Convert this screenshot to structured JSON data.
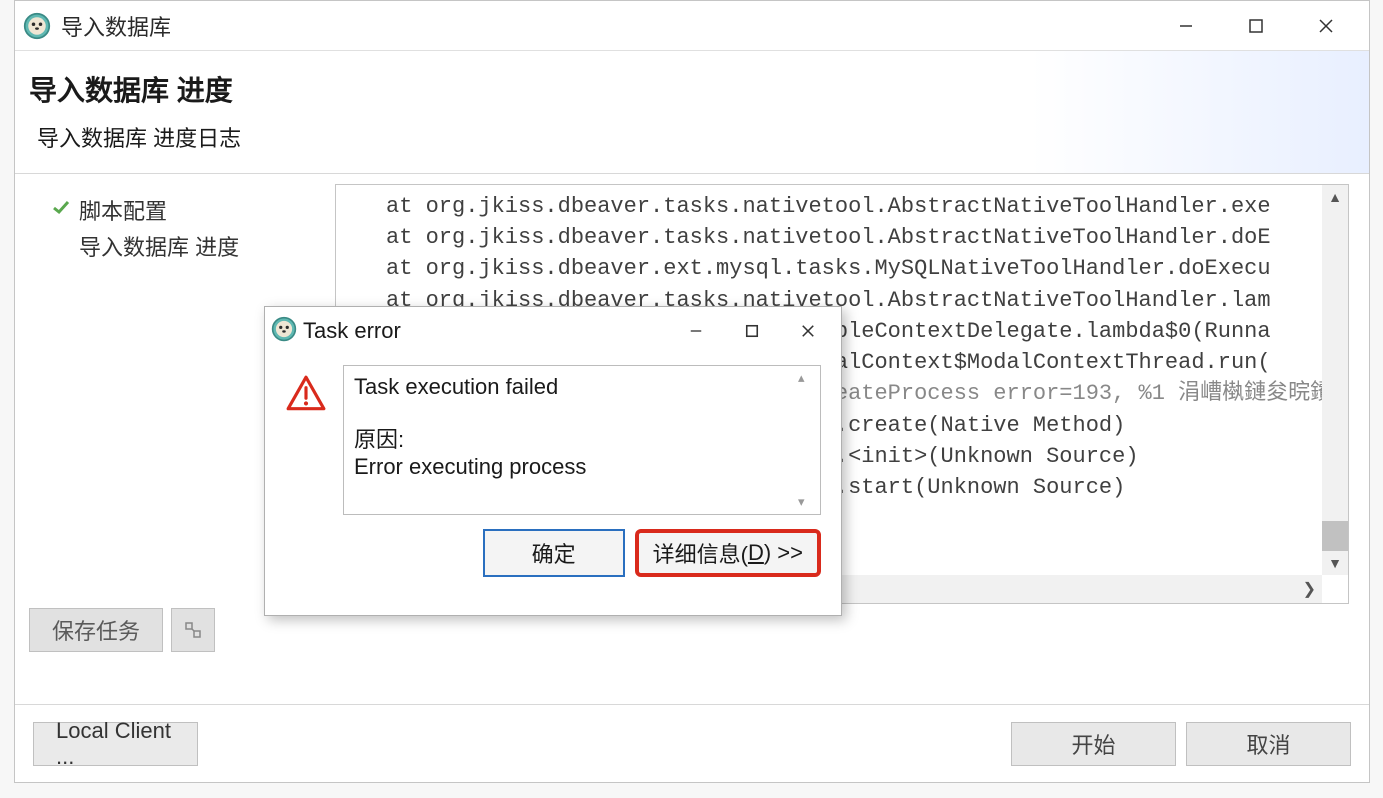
{
  "window": {
    "title": "导入数据库"
  },
  "header": {
    "page_title": "导入数据库 进度",
    "page_subtitle": "导入数据库 进度日志"
  },
  "sidebar": {
    "items": [
      {
        "label": "脚本配置",
        "done": true
      },
      {
        "label": "导入数据库 进度",
        "done": false
      }
    ]
  },
  "log": {
    "lines": [
      "at org.jkiss.dbeaver.tasks.nativetool.AbstractNativeToolHandler.exe",
      "at org.jkiss.dbeaver.tasks.nativetool.AbstractNativeToolHandler.doE",
      "at org.jkiss.dbeaver.ext.mysql.tasks.MySQLNativeToolHandler.doExecu",
      "at org.jkiss.dbeaver.tasks.nativetool.AbstractNativeToolHandler.lam",
      "at org.jkiss.dbeaver.runtime.RunnableContextDelegate.lambda$0(Runna",
      "at org.eclipse.jface.operation.ModalContext$ModalContextThread.run(",
      "Caused by: java.io.IOException: CreateProcess error=193, %1 涓嶆槸鏈夋晥鐨",
      "at java.base/java.lang.ProcessImpl.create(Native Method)",
      "at java.base/java.lang.ProcessImpl.<init>(Unknown Source)",
      "at java.base/java.lang.ProcessImpl.start(Unknown Source)"
    ]
  },
  "toolbar": {
    "save_label": "保存任务"
  },
  "footer": {
    "local_client_label": "Local Client ...",
    "start_label": "开始",
    "cancel_label": "取消"
  },
  "modal": {
    "title": "Task error",
    "message_title": "Task execution failed",
    "reason_label": "原因:",
    "reason_text": " Error executing process",
    "ok_label": "确定",
    "details_prefix": "详细信息(",
    "details_key": "D",
    "details_suffix": ") >>"
  }
}
